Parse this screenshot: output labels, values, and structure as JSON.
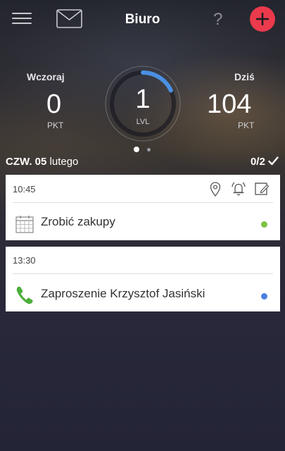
{
  "header": {
    "title": "Biuro",
    "help_label": "?",
    "icons": [
      "menu-icon",
      "mail-icon",
      "help-icon",
      "plus-icon"
    ],
    "add_button_color": "#ea3a4c"
  },
  "stats": {
    "yesterday": {
      "label": "Wczoraj",
      "value": "0",
      "unit": "PKT"
    },
    "today": {
      "label": "Dziś",
      "value": "104",
      "unit": "PKT"
    },
    "level": {
      "value": "1",
      "unit": "LVL",
      "progress": 0.18,
      "color": "#4a90e2"
    },
    "pager": {
      "pages": 2,
      "active": 1
    }
  },
  "date": {
    "day": "CZW.",
    "day_num": "05",
    "month": "lutego",
    "count": "0/2"
  },
  "tasks": [
    {
      "time": "10:45",
      "title": "Zrobić zakupy",
      "icon": "calendar-icon",
      "status_color": "#7dc243",
      "actions": [
        "location-icon",
        "alarm-icon",
        "note-edit-icon"
      ]
    },
    {
      "time": "13:30",
      "title": "Zaproszenie Krzysztof  Jasiński",
      "icon": "phone-icon",
      "status_color": "#4a7fe0"
    }
  ]
}
